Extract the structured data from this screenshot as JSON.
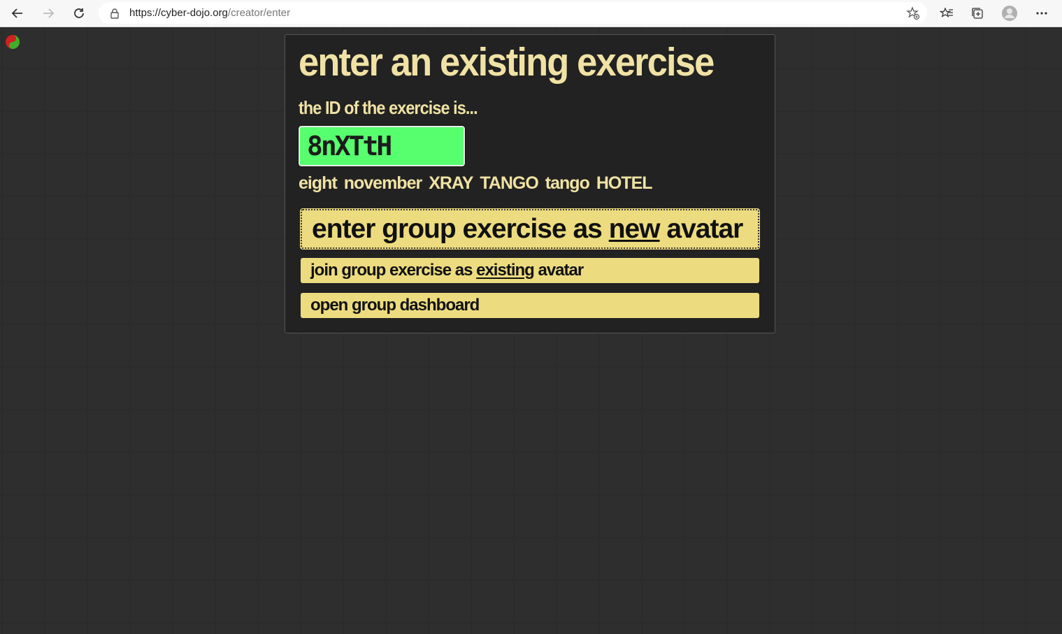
{
  "browser": {
    "url_host": "https://cyber-dojo.org",
    "url_path": "/creator/enter"
  },
  "panel": {
    "title": "enter an existing exercise",
    "prompt": "the ID of the exercise is...",
    "exercise_id": "8nXTtH",
    "spelled_id": [
      "eight",
      "november",
      "XRAY",
      "TANGO",
      "tango",
      "HOTEL"
    ],
    "buttons": {
      "new_prefix": "enter group exercise as ",
      "new_underlined": "new",
      "new_suffix": " avatar",
      "existing_prefix": "join group exercise as ",
      "existing_underlined": "existing",
      "existing_suffix": " avatar",
      "dashboard": "open group dashboard"
    }
  },
  "colors": {
    "accent_text": "#f0e2a4",
    "id_field": "#57ff6f",
    "button": "#eddc7f",
    "background": "#262626"
  },
  "icons": [
    "back-icon",
    "forward-icon",
    "reload-icon",
    "lock-icon",
    "add-favorite-icon",
    "favorites-icon",
    "collections-icon",
    "profile-icon",
    "more-icon",
    "cyber-dojo-logo-icon"
  ]
}
